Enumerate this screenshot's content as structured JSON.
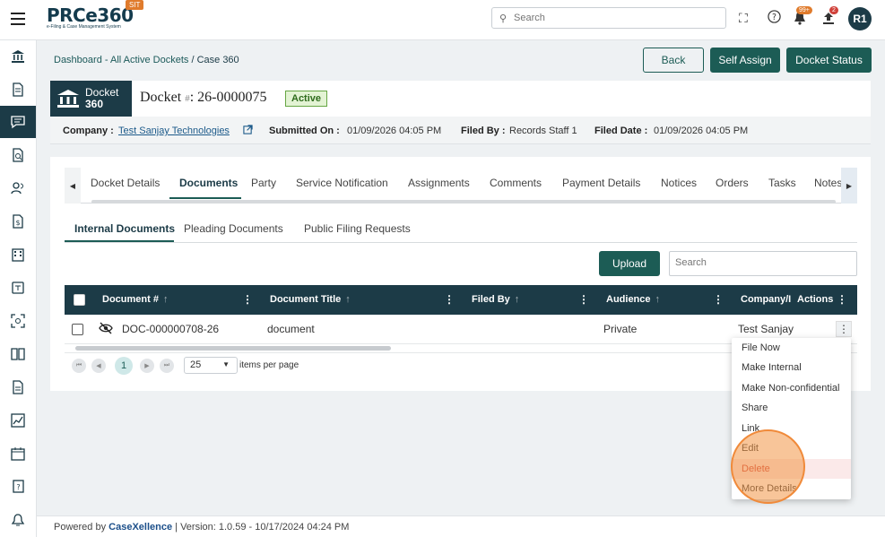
{
  "app": {
    "logo_text": "PRCe360",
    "logo_subtitle": "e-Filing & Case Management System",
    "env_badge": "SIT",
    "search_placeholder": "Search",
    "notifications_badge": "99+",
    "uploads_badge": "2",
    "avatar_initials": "R1"
  },
  "breadcrumb": {
    "part1": "Dashboard - All Active Dockets",
    "separator": " / ",
    "part2": "Case 360"
  },
  "header_buttons": {
    "back": "Back",
    "self_assign": "Self Assign",
    "docket_status": "Docket Status"
  },
  "docket": {
    "tag_line1": "Docket",
    "tag_line2": "360",
    "title_prefix": "Docket ",
    "title_hash": "#",
    "title_sep": ": ",
    "number": "26-0000075",
    "status": "Active"
  },
  "info": {
    "company_label": "Company :",
    "company_value": "Test Sanjay Technologies",
    "submitted_label": "Submitted On :",
    "submitted_value": "01/09/2026 04:05 PM",
    "filed_by_label": "Filed By :",
    "filed_by_value": "Records Staff 1",
    "filed_date_label": "Filed Date :",
    "filed_date_value": "01/09/2026 04:05 PM"
  },
  "tabs": [
    "Docket Details",
    "Documents",
    "Party",
    "Service Notification",
    "Assignments",
    "Comments",
    "Payment Details",
    "Notices",
    "Orders",
    "Tasks",
    "Notes"
  ],
  "subtabs": [
    "Internal Documents",
    "Pleading Documents",
    "Public Filing Requests"
  ],
  "grid": {
    "upload": "Upload",
    "search_placeholder": "Search",
    "columns": [
      "Document #",
      "Document Title",
      "Filed By",
      "Audience",
      "Company/I",
      "Actions"
    ],
    "row": {
      "doc_no": "DOC-000000708-26",
      "title": "document",
      "filed_by": "",
      "audience": "Private",
      "company": "Test Sanjay"
    },
    "pager": {
      "current_page": "1",
      "page_size": "25",
      "label": "items per page"
    }
  },
  "actions_menu": [
    "File Now",
    "Make Internal",
    "Make Non-confidential",
    "Share",
    "Link",
    "Edit",
    "Delete",
    "More Details"
  ],
  "footer": {
    "powered_by": "Powered by ",
    "brand": "CaseXellence",
    "version": "  |  Version: 1.0.59 - 10/17/2024 04:24 PM"
  }
}
